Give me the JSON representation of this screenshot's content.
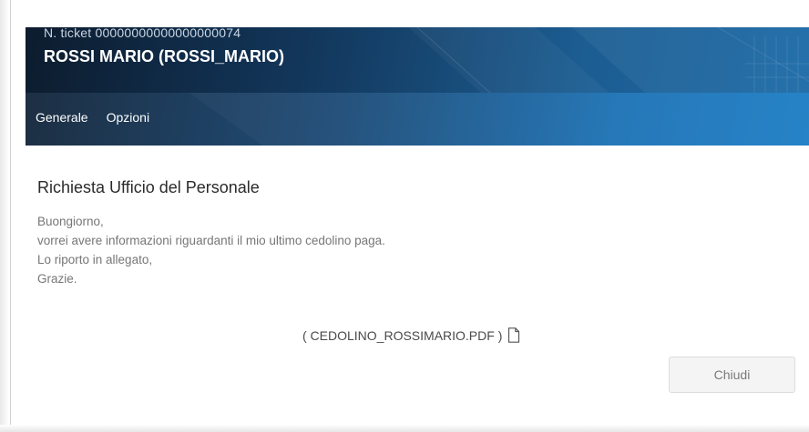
{
  "header": {
    "ticket_number": "N. ticket 00000000000000000074",
    "user_name": "ROSSI MARIO (ROSSI_MARIO)"
  },
  "tabs": [
    {
      "label": "Generale"
    },
    {
      "label": "Opzioni"
    }
  ],
  "request": {
    "title": "Richiesta Ufficio del Personale",
    "message_lines": [
      "Buongiorno,",
      "vorrei avere informazioni riguardanti il mio ultimo cedolino paga.",
      "Lo riporto in allegato,",
      "Grazie."
    ],
    "attachment": "( CEDOLINO_ROSSIMARIO.PDF )",
    "attachment_icon": "file-icon"
  },
  "actions": {
    "close_label": "Chiudi"
  },
  "colors": {
    "header_dark": "#0d1c2e",
    "header_blue": "#1f7fc6",
    "title_text": "#2b2b2b",
    "body_text": "#767676"
  }
}
